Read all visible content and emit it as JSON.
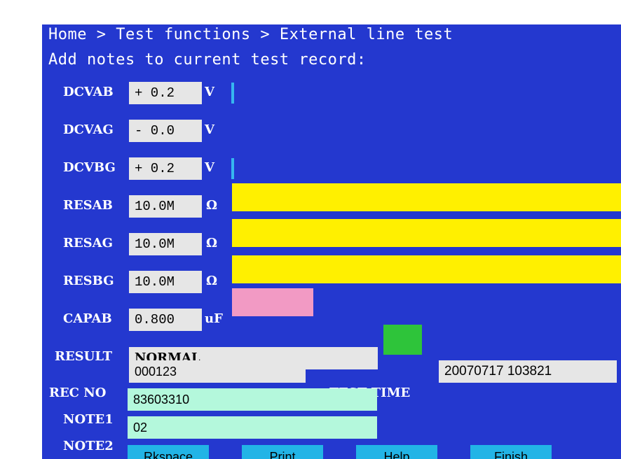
{
  "breadcrumb": "Home > Test functions > External line test",
  "subtitle": "Add notes to current test record:",
  "measurements": [
    {
      "label": "DCVAB",
      "value": "+ 0.2",
      "unit": "V",
      "bar_color": "#36b6f0"
    },
    {
      "label": "DCVAG",
      "value": "- 0.0",
      "unit": "V",
      "bar_color": ""
    },
    {
      "label": "DCVBG",
      "value": "+ 0.2",
      "unit": "V",
      "bar_color": "#36b6f0"
    },
    {
      "label": "RESAB",
      "value": "10.0M",
      "unit": "Ω",
      "bar_color": "#fff000"
    },
    {
      "label": "RESAG",
      "value": "10.0M",
      "unit": "Ω",
      "bar_color": "#fff000"
    },
    {
      "label": "RESBG",
      "value": "10.0M",
      "unit": "Ω",
      "bar_color": "#fff000"
    },
    {
      "label": "CAPAB",
      "value": "0.800",
      "unit": "uF",
      "bar_color": "#f29ac4"
    }
  ],
  "result": {
    "label": "RESULT",
    "value": "NORMAL",
    "indicator_color": "#2ec43a"
  },
  "record": {
    "label": "REC NO",
    "value": "000123",
    "time_label": "TEST TIME",
    "time_value": "20070717 103821"
  },
  "notes": [
    {
      "label": "NOTE1",
      "value": "83603310"
    },
    {
      "label": "NOTE2",
      "value": "02"
    }
  ],
  "buttons": [
    "Rkspace",
    "Print",
    "Help",
    "Finish"
  ],
  "colors": {
    "screen_bg": "#2438cf",
    "field_bg": "#e6e6e6",
    "note_bg": "#b4f8dc",
    "button_bg": "#22b4e6"
  }
}
